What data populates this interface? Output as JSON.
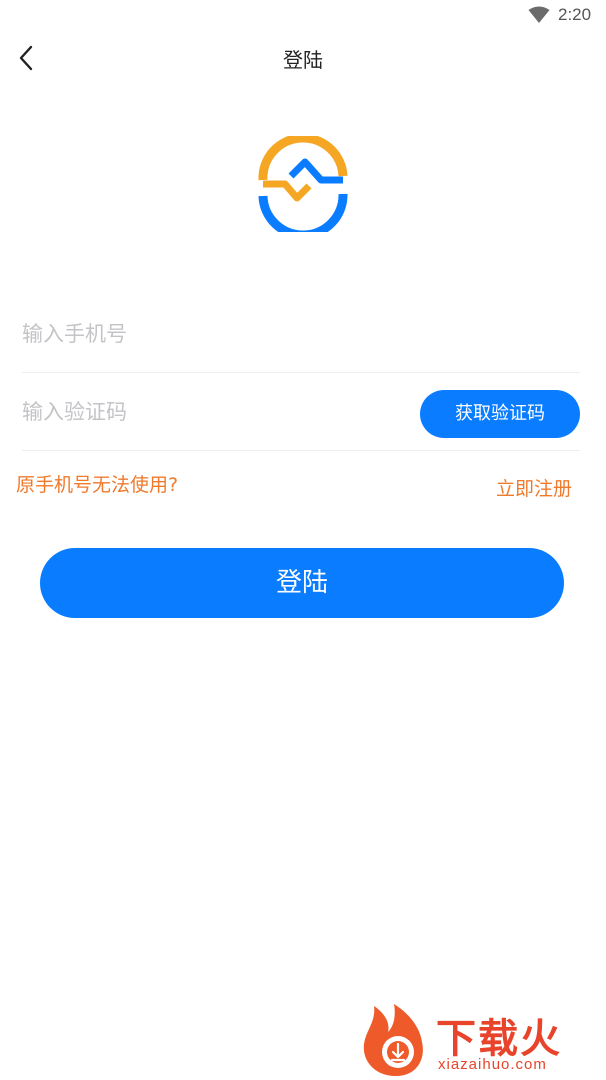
{
  "status_bar": {
    "time": "2:20",
    "icon": "wifi-icon"
  },
  "header": {
    "back_icon": "chevron-left-icon",
    "title": "登陆"
  },
  "logo": {
    "icon": "app-logo",
    "colors": [
      "#f5a623",
      "#0a7cff"
    ]
  },
  "form": {
    "phone_placeholder": "输入手机号",
    "phone_value": "",
    "code_placeholder": "输入验证码",
    "code_value": "",
    "get_code_label": "获取验证码"
  },
  "links": {
    "phone_unusable": "原手机号无法使用?",
    "register": "立即注册"
  },
  "login_button": "登陆",
  "watermark": {
    "text": "下载火",
    "sub": "xiazaihuo.com"
  },
  "colors": {
    "accent": "#0a7cff",
    "link": "#f07a2c",
    "watermark": "#e8442b"
  }
}
